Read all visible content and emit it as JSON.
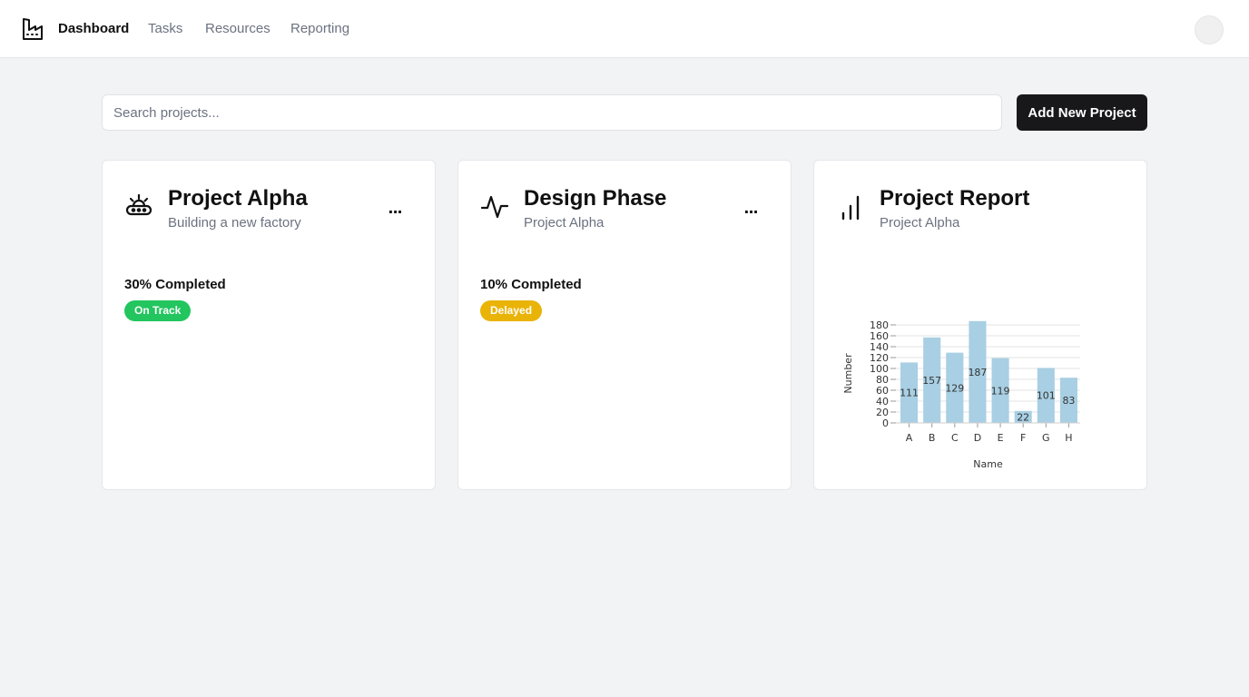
{
  "nav": {
    "logo_icon": "factory-icon",
    "items": [
      {
        "label": "Dashboard",
        "active": true
      },
      {
        "label": "Tasks",
        "active": false
      },
      {
        "label": "Resources",
        "active": false
      },
      {
        "label": "Reporting",
        "active": false
      }
    ]
  },
  "search": {
    "placeholder": "Search projects..."
  },
  "actions": {
    "add_project_label": "Add New Project"
  },
  "cards": [
    {
      "icon": "conveyor-icon",
      "title": "Project Alpha",
      "subtitle": "Building a new factory",
      "more_label": "...",
      "completed": "30% Completed",
      "progress": 0.3,
      "status": "On Track",
      "status_color": "#22c55e"
    },
    {
      "icon": "activity-icon",
      "title": "Design Phase",
      "subtitle": "Project Alpha",
      "more_label": "...",
      "completed": "10% Completed",
      "progress": 0.1,
      "status": "Delayed",
      "status_color": "#eab308"
    },
    {
      "icon": "bar-chart-icon",
      "title": "Project Report",
      "subtitle": "Project Alpha"
    }
  ],
  "chart_data": {
    "type": "bar",
    "categories": [
      "A",
      "B",
      "C",
      "D",
      "E",
      "F",
      "G",
      "H"
    ],
    "values": [
      111,
      157,
      129,
      187,
      119,
      22,
      101,
      83
    ],
    "title": "",
    "xlabel": "Name",
    "ylabel": "Number",
    "ylim": [
      0,
      180
    ],
    "yticks": [
      0,
      20,
      40,
      60,
      80,
      100,
      120,
      140,
      160,
      180
    ],
    "grid": true,
    "bar_color": "#a8cfe3",
    "data_labels": true
  }
}
